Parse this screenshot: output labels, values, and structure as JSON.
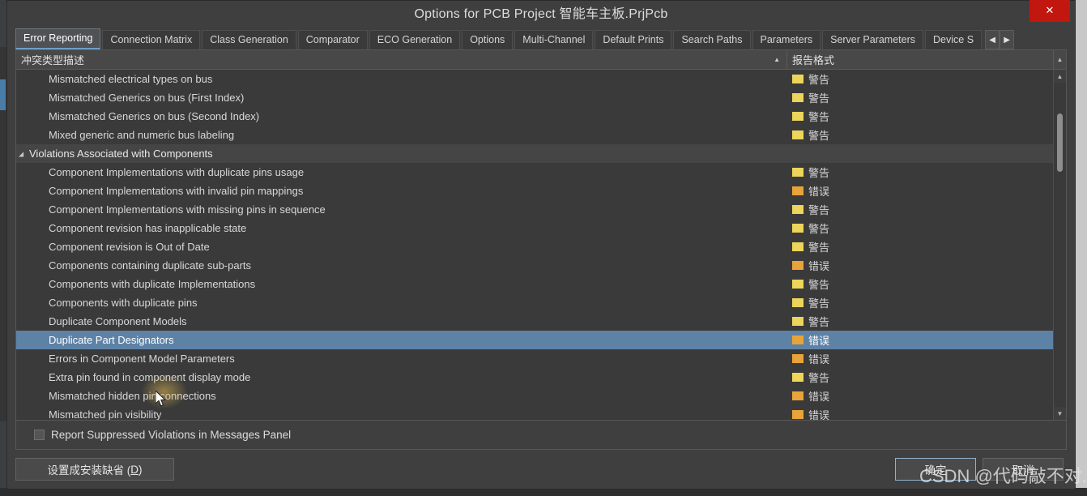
{
  "window": {
    "title": "Options for PCB Project 智能车主板.PrjPcb",
    "close_label": "✕"
  },
  "tabs": [
    {
      "label": "Error Reporting",
      "active": true
    },
    {
      "label": "Connection Matrix",
      "active": false
    },
    {
      "label": "Class Generation",
      "active": false
    },
    {
      "label": "Comparator",
      "active": false
    },
    {
      "label": "ECO Generation",
      "active": false
    },
    {
      "label": "Options",
      "active": false
    },
    {
      "label": "Multi-Channel",
      "active": false
    },
    {
      "label": "Default Prints",
      "active": false
    },
    {
      "label": "Search Paths",
      "active": false
    },
    {
      "label": "Parameters",
      "active": false
    },
    {
      "label": "Server Parameters",
      "active": false
    },
    {
      "label": "Device S",
      "active": false
    }
  ],
  "tab_nav": {
    "prev_label": "◀",
    "next_label": "▶"
  },
  "grid": {
    "columns": [
      {
        "key": "description",
        "label": "冲突类型描述",
        "sort_indicator": "▲"
      },
      {
        "key": "report_format",
        "label": "报告格式"
      }
    ],
    "rows": [
      {
        "type": "item",
        "description": "Mismatched electrical types on bus",
        "report_format": "警告",
        "severity": "warn",
        "selected": false
      },
      {
        "type": "item",
        "description": "Mismatched Generics on bus (First Index)",
        "report_format": "警告",
        "severity": "warn",
        "selected": false
      },
      {
        "type": "item",
        "description": "Mismatched Generics on bus (Second Index)",
        "report_format": "警告",
        "severity": "warn",
        "selected": false
      },
      {
        "type": "item",
        "description": "Mixed generic and numeric bus labeling",
        "report_format": "警告",
        "severity": "warn",
        "selected": false
      },
      {
        "type": "group",
        "description": "Violations Associated with Components",
        "report_format": "",
        "severity": "none",
        "selected": false,
        "expander": "◢"
      },
      {
        "type": "item",
        "description": "Component Implementations with duplicate pins usage",
        "report_format": "警告",
        "severity": "warn",
        "selected": false
      },
      {
        "type": "item",
        "description": "Component Implementations with invalid pin mappings",
        "report_format": "错误",
        "severity": "err",
        "selected": false
      },
      {
        "type": "item",
        "description": "Component Implementations with missing pins in sequence",
        "report_format": "警告",
        "severity": "warn",
        "selected": false
      },
      {
        "type": "item",
        "description": "Component revision has inapplicable state",
        "report_format": "警告",
        "severity": "warn",
        "selected": false
      },
      {
        "type": "item",
        "description": "Component revision is Out of Date",
        "report_format": "警告",
        "severity": "warn",
        "selected": false
      },
      {
        "type": "item",
        "description": "Components containing duplicate sub-parts",
        "report_format": "错误",
        "severity": "err",
        "selected": false
      },
      {
        "type": "item",
        "description": "Components with duplicate Implementations",
        "report_format": "警告",
        "severity": "warn",
        "selected": false
      },
      {
        "type": "item",
        "description": "Components with duplicate pins",
        "report_format": "警告",
        "severity": "warn",
        "selected": false
      },
      {
        "type": "item",
        "description": "Duplicate Component Models",
        "report_format": "警告",
        "severity": "warn",
        "selected": false
      },
      {
        "type": "item",
        "description": "Duplicate Part Designators",
        "report_format": "错误",
        "severity": "err",
        "selected": true
      },
      {
        "type": "item",
        "description": "Errors in Component Model Parameters",
        "report_format": "错误",
        "severity": "err",
        "selected": false
      },
      {
        "type": "item",
        "description": "Extra pin found in component display mode",
        "report_format": "警告",
        "severity": "warn",
        "selected": false
      },
      {
        "type": "item",
        "description": "Mismatched hidden pin connections",
        "report_format": "错误",
        "severity": "err",
        "selected": false
      },
      {
        "type": "item",
        "description": "Mismatched pin visibility",
        "report_format": "错误",
        "severity": "err",
        "selected": false
      }
    ]
  },
  "scrollbar": {
    "up_label": "▲",
    "down_label": "▼",
    "corner_label": "▲"
  },
  "suppressed": {
    "label": "Report Suppressed Violations in Messages Panel",
    "checked": false
  },
  "footer": {
    "defaults_label": "设置成安装缺省 (",
    "defaults_accel": "D",
    "defaults_suffix": ")",
    "ok_label": "确定",
    "cancel_label": "取消"
  },
  "watermark": {
    "text": "CSDN @代码敲不对."
  },
  "colors": {
    "dialog_bg": "#3f3f3f",
    "list_bg": "#3a3a3a",
    "selection": "#5e82a6",
    "group_bg": "#454545",
    "warning_folder": "#ecd55a",
    "error_folder": "#e8a43a",
    "close_red": "#c1170f",
    "text": "#d8d8d8"
  }
}
